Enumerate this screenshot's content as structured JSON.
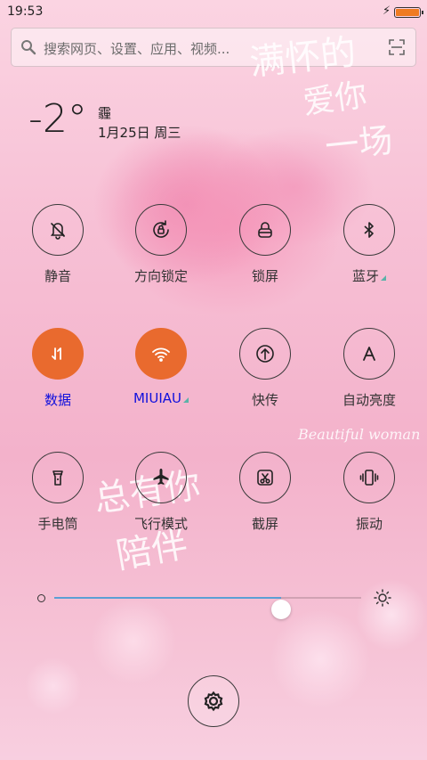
{
  "status": {
    "time": "19:53",
    "battery_level": 1.0,
    "battery_color": "#ef7b22"
  },
  "search": {
    "placeholder": "搜索网页、设置、应用、视频..."
  },
  "weather": {
    "temperature": "-2°",
    "condition": "霾",
    "date": "1月25日 周三"
  },
  "wallpaper_text": {
    "line1": "满怀的",
    "line2": "爱你",
    "line3": "一场",
    "english": "Beautiful woman",
    "line4": "总有你",
    "line5": "陪伴"
  },
  "toggles": [
    {
      "label": "静音",
      "icon": "bell-off-icon",
      "active": false
    },
    {
      "label": "方向锁定",
      "icon": "rotation-lock-icon",
      "active": false
    },
    {
      "label": "锁屏",
      "icon": "lock-icon",
      "active": false
    },
    {
      "label": "蓝牙",
      "icon": "bluetooth-icon",
      "active": false,
      "has_more": true
    },
    {
      "label": "数据",
      "icon": "data-arrows-icon",
      "active": true
    },
    {
      "label": "MIUIAU",
      "icon": "wifi-icon",
      "active": true,
      "has_more": true
    },
    {
      "label": "快传",
      "icon": "upload-icon",
      "active": false
    },
    {
      "label": "自动亮度",
      "icon": "auto-brightness-icon",
      "active": false
    },
    {
      "label": "手电筒",
      "icon": "flashlight-icon",
      "active": false
    },
    {
      "label": "飞行模式",
      "icon": "airplane-icon",
      "active": false
    },
    {
      "label": "截屏",
      "icon": "screenshot-icon",
      "active": false
    },
    {
      "label": "振动",
      "icon": "vibrate-icon",
      "active": false
    }
  ],
  "brightness": {
    "level": 0.74,
    "accent": "#5b9fd4"
  },
  "colors": {
    "active_toggle": "#e96a2e",
    "active_label": "#1010dd"
  }
}
